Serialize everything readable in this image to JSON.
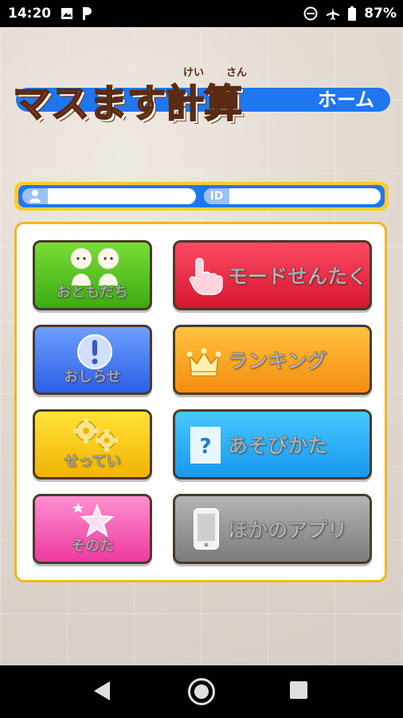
{
  "status": {
    "time": "14:20",
    "battery": "87%"
  },
  "header": {
    "logo_chars": [
      "マ",
      "ス",
      "ま",
      "す",
      "計",
      "算"
    ],
    "ruby": [
      "けい",
      "さん"
    ],
    "screen_label": "ホーム"
  },
  "user": {
    "name_tag_icon": "person-icon",
    "name_value": "",
    "id_tag": "ID",
    "id_value": ""
  },
  "menu": {
    "friends": "おともだち",
    "notices": "おしらせ",
    "settings": "せってい",
    "others": "そのた",
    "mode_select": "モードせんたく",
    "ranking": "ランキング",
    "how_to_play": "あそびかた",
    "other_apps": "ほかのアプリ"
  }
}
